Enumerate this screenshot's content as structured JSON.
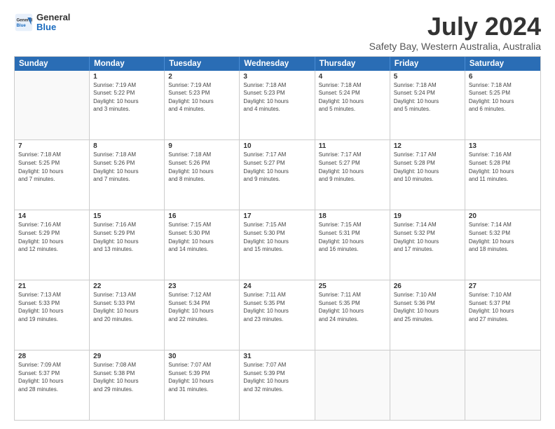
{
  "logo": {
    "general": "General",
    "blue": "Blue"
  },
  "title": "July 2024",
  "location": "Safety Bay, Western Australia, Australia",
  "headers": [
    "Sunday",
    "Monday",
    "Tuesday",
    "Wednesday",
    "Thursday",
    "Friday",
    "Saturday"
  ],
  "rows": [
    [
      {
        "day": "",
        "info": "",
        "empty": true
      },
      {
        "day": "1",
        "info": "Sunrise: 7:19 AM\nSunset: 5:22 PM\nDaylight: 10 hours\nand 3 minutes."
      },
      {
        "day": "2",
        "info": "Sunrise: 7:19 AM\nSunset: 5:23 PM\nDaylight: 10 hours\nand 4 minutes."
      },
      {
        "day": "3",
        "info": "Sunrise: 7:18 AM\nSunset: 5:23 PM\nDaylight: 10 hours\nand 4 minutes."
      },
      {
        "day": "4",
        "info": "Sunrise: 7:18 AM\nSunset: 5:24 PM\nDaylight: 10 hours\nand 5 minutes."
      },
      {
        "day": "5",
        "info": "Sunrise: 7:18 AM\nSunset: 5:24 PM\nDaylight: 10 hours\nand 5 minutes."
      },
      {
        "day": "6",
        "info": "Sunrise: 7:18 AM\nSunset: 5:25 PM\nDaylight: 10 hours\nand 6 minutes."
      }
    ],
    [
      {
        "day": "7",
        "info": "Sunrise: 7:18 AM\nSunset: 5:25 PM\nDaylight: 10 hours\nand 7 minutes."
      },
      {
        "day": "8",
        "info": "Sunrise: 7:18 AM\nSunset: 5:26 PM\nDaylight: 10 hours\nand 7 minutes."
      },
      {
        "day": "9",
        "info": "Sunrise: 7:18 AM\nSunset: 5:26 PM\nDaylight: 10 hours\nand 8 minutes."
      },
      {
        "day": "10",
        "info": "Sunrise: 7:17 AM\nSunset: 5:27 PM\nDaylight: 10 hours\nand 9 minutes."
      },
      {
        "day": "11",
        "info": "Sunrise: 7:17 AM\nSunset: 5:27 PM\nDaylight: 10 hours\nand 9 minutes."
      },
      {
        "day": "12",
        "info": "Sunrise: 7:17 AM\nSunset: 5:28 PM\nDaylight: 10 hours\nand 10 minutes."
      },
      {
        "day": "13",
        "info": "Sunrise: 7:16 AM\nSunset: 5:28 PM\nDaylight: 10 hours\nand 11 minutes."
      }
    ],
    [
      {
        "day": "14",
        "info": "Sunrise: 7:16 AM\nSunset: 5:29 PM\nDaylight: 10 hours\nand 12 minutes."
      },
      {
        "day": "15",
        "info": "Sunrise: 7:16 AM\nSunset: 5:29 PM\nDaylight: 10 hours\nand 13 minutes."
      },
      {
        "day": "16",
        "info": "Sunrise: 7:15 AM\nSunset: 5:30 PM\nDaylight: 10 hours\nand 14 minutes."
      },
      {
        "day": "17",
        "info": "Sunrise: 7:15 AM\nSunset: 5:30 PM\nDaylight: 10 hours\nand 15 minutes."
      },
      {
        "day": "18",
        "info": "Sunrise: 7:15 AM\nSunset: 5:31 PM\nDaylight: 10 hours\nand 16 minutes."
      },
      {
        "day": "19",
        "info": "Sunrise: 7:14 AM\nSunset: 5:32 PM\nDaylight: 10 hours\nand 17 minutes."
      },
      {
        "day": "20",
        "info": "Sunrise: 7:14 AM\nSunset: 5:32 PM\nDaylight: 10 hours\nand 18 minutes."
      }
    ],
    [
      {
        "day": "21",
        "info": "Sunrise: 7:13 AM\nSunset: 5:33 PM\nDaylight: 10 hours\nand 19 minutes."
      },
      {
        "day": "22",
        "info": "Sunrise: 7:13 AM\nSunset: 5:33 PM\nDaylight: 10 hours\nand 20 minutes."
      },
      {
        "day": "23",
        "info": "Sunrise: 7:12 AM\nSunset: 5:34 PM\nDaylight: 10 hours\nand 22 minutes."
      },
      {
        "day": "24",
        "info": "Sunrise: 7:11 AM\nSunset: 5:35 PM\nDaylight: 10 hours\nand 23 minutes."
      },
      {
        "day": "25",
        "info": "Sunrise: 7:11 AM\nSunset: 5:35 PM\nDaylight: 10 hours\nand 24 minutes."
      },
      {
        "day": "26",
        "info": "Sunrise: 7:10 AM\nSunset: 5:36 PM\nDaylight: 10 hours\nand 25 minutes."
      },
      {
        "day": "27",
        "info": "Sunrise: 7:10 AM\nSunset: 5:37 PM\nDaylight: 10 hours\nand 27 minutes."
      }
    ],
    [
      {
        "day": "28",
        "info": "Sunrise: 7:09 AM\nSunset: 5:37 PM\nDaylight: 10 hours\nand 28 minutes."
      },
      {
        "day": "29",
        "info": "Sunrise: 7:08 AM\nSunset: 5:38 PM\nDaylight: 10 hours\nand 29 minutes."
      },
      {
        "day": "30",
        "info": "Sunrise: 7:07 AM\nSunset: 5:39 PM\nDaylight: 10 hours\nand 31 minutes."
      },
      {
        "day": "31",
        "info": "Sunrise: 7:07 AM\nSunset: 5:39 PM\nDaylight: 10 hours\nand 32 minutes."
      },
      {
        "day": "",
        "info": "",
        "empty": true
      },
      {
        "day": "",
        "info": "",
        "empty": true
      },
      {
        "day": "",
        "info": "",
        "empty": true
      }
    ]
  ]
}
